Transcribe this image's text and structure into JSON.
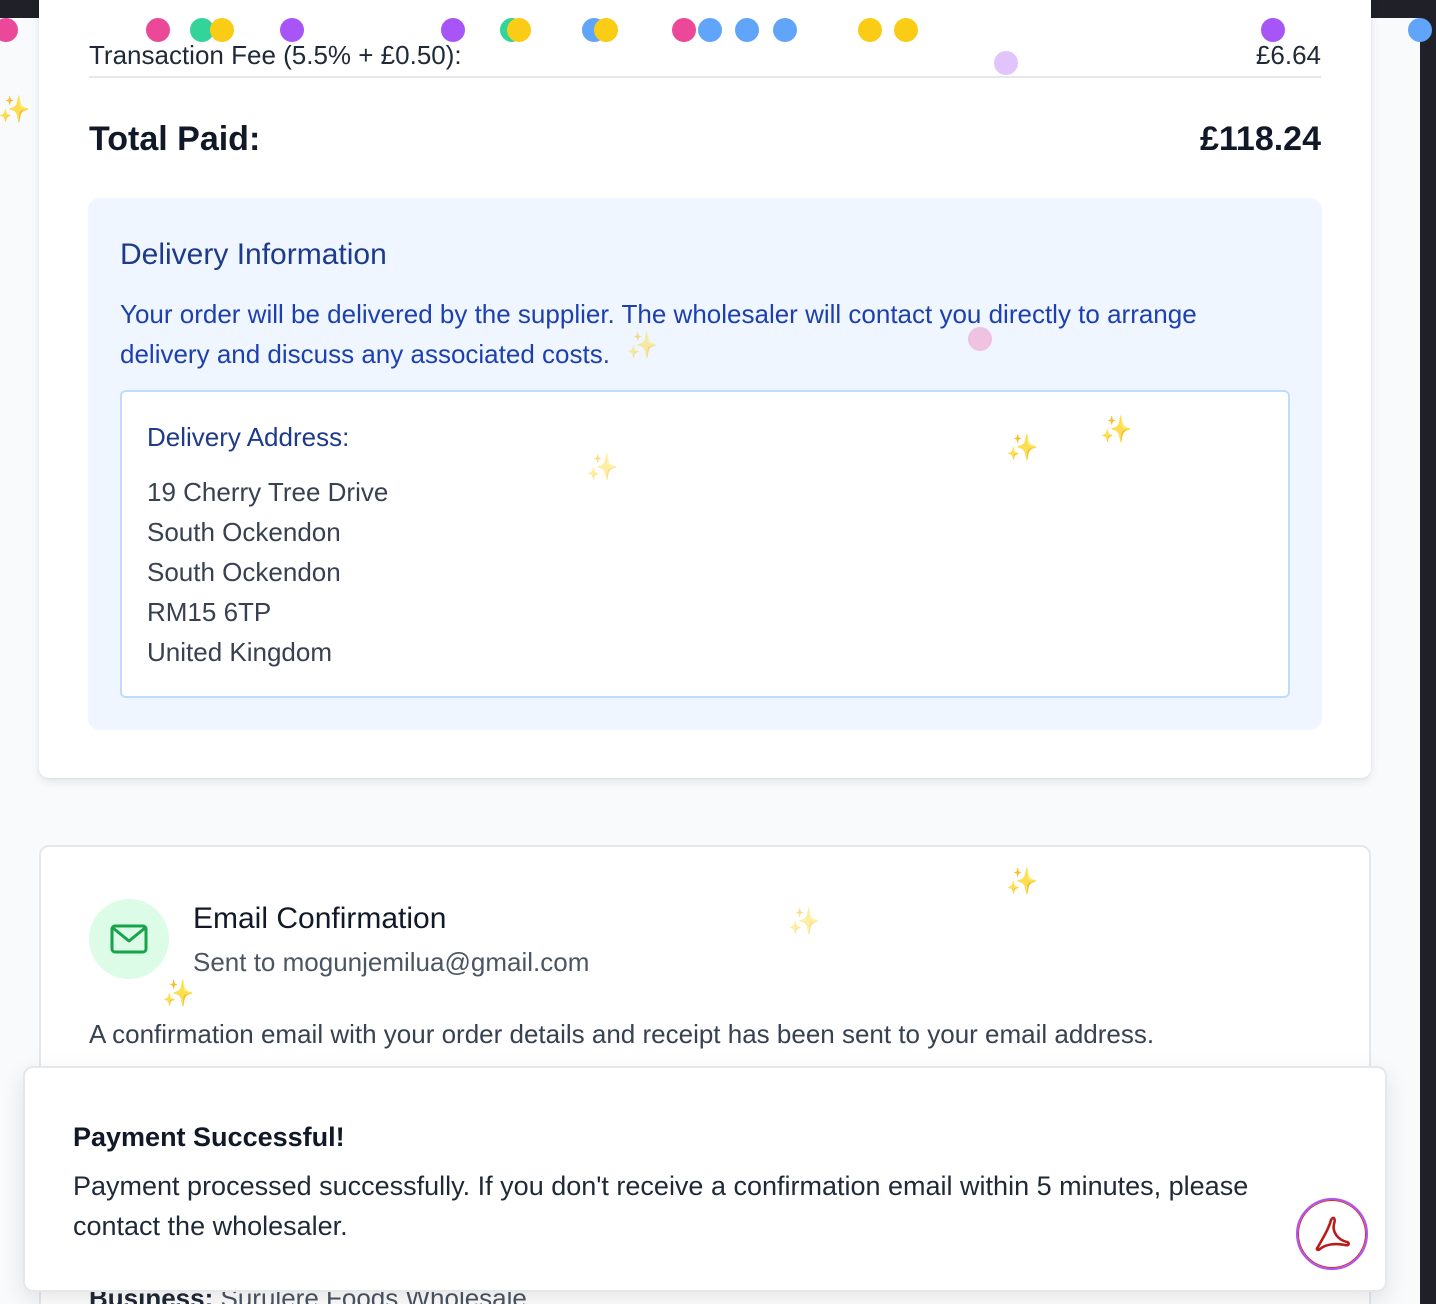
{
  "summary": {
    "fee_label": "Transaction Fee (5.5% + £0.50):",
    "fee_value": "£6.64",
    "total_label": "Total Paid:",
    "total_value": "£118.24"
  },
  "delivery": {
    "title": "Delivery Information",
    "text": "Your order will be delivered by the supplier. The wholesaler will contact you directly to arrange delivery and discuss any associated costs.",
    "address_label": "Delivery Address:",
    "address_lines": [
      "19 Cherry Tree Drive",
      "South Ockendon",
      "South Ockendon",
      "RM15 6TP",
      "United Kingdom"
    ]
  },
  "email": {
    "icon": "mail-icon",
    "title": "Email Confirmation",
    "sent_to": "Sent to mogunjemilua@gmail.com",
    "description": "A confirmation email with your order details and receipt has been sent to your email address.",
    "business_label": "Business:",
    "business_value": "Surulere Foods Wholesale"
  },
  "toast": {
    "title": "Payment Successful!",
    "message": "Payment processed successfully. If you don't receive a confirmation email within 5 minutes, please contact the wholesaler."
  },
  "pdf_button": {
    "icon": "adobe-pdf-icon"
  },
  "colors": {
    "confetti": [
      "#ec4899",
      "#34d399",
      "#facc15",
      "#a855f7",
      "#60a5fa"
    ],
    "delivery_bg": "#eff6ff",
    "delivery_text": "#1e40af",
    "email_icon_bg": "#dcfce7",
    "email_icon": "#16a34a",
    "pdf_icon": "#b91c1c"
  }
}
